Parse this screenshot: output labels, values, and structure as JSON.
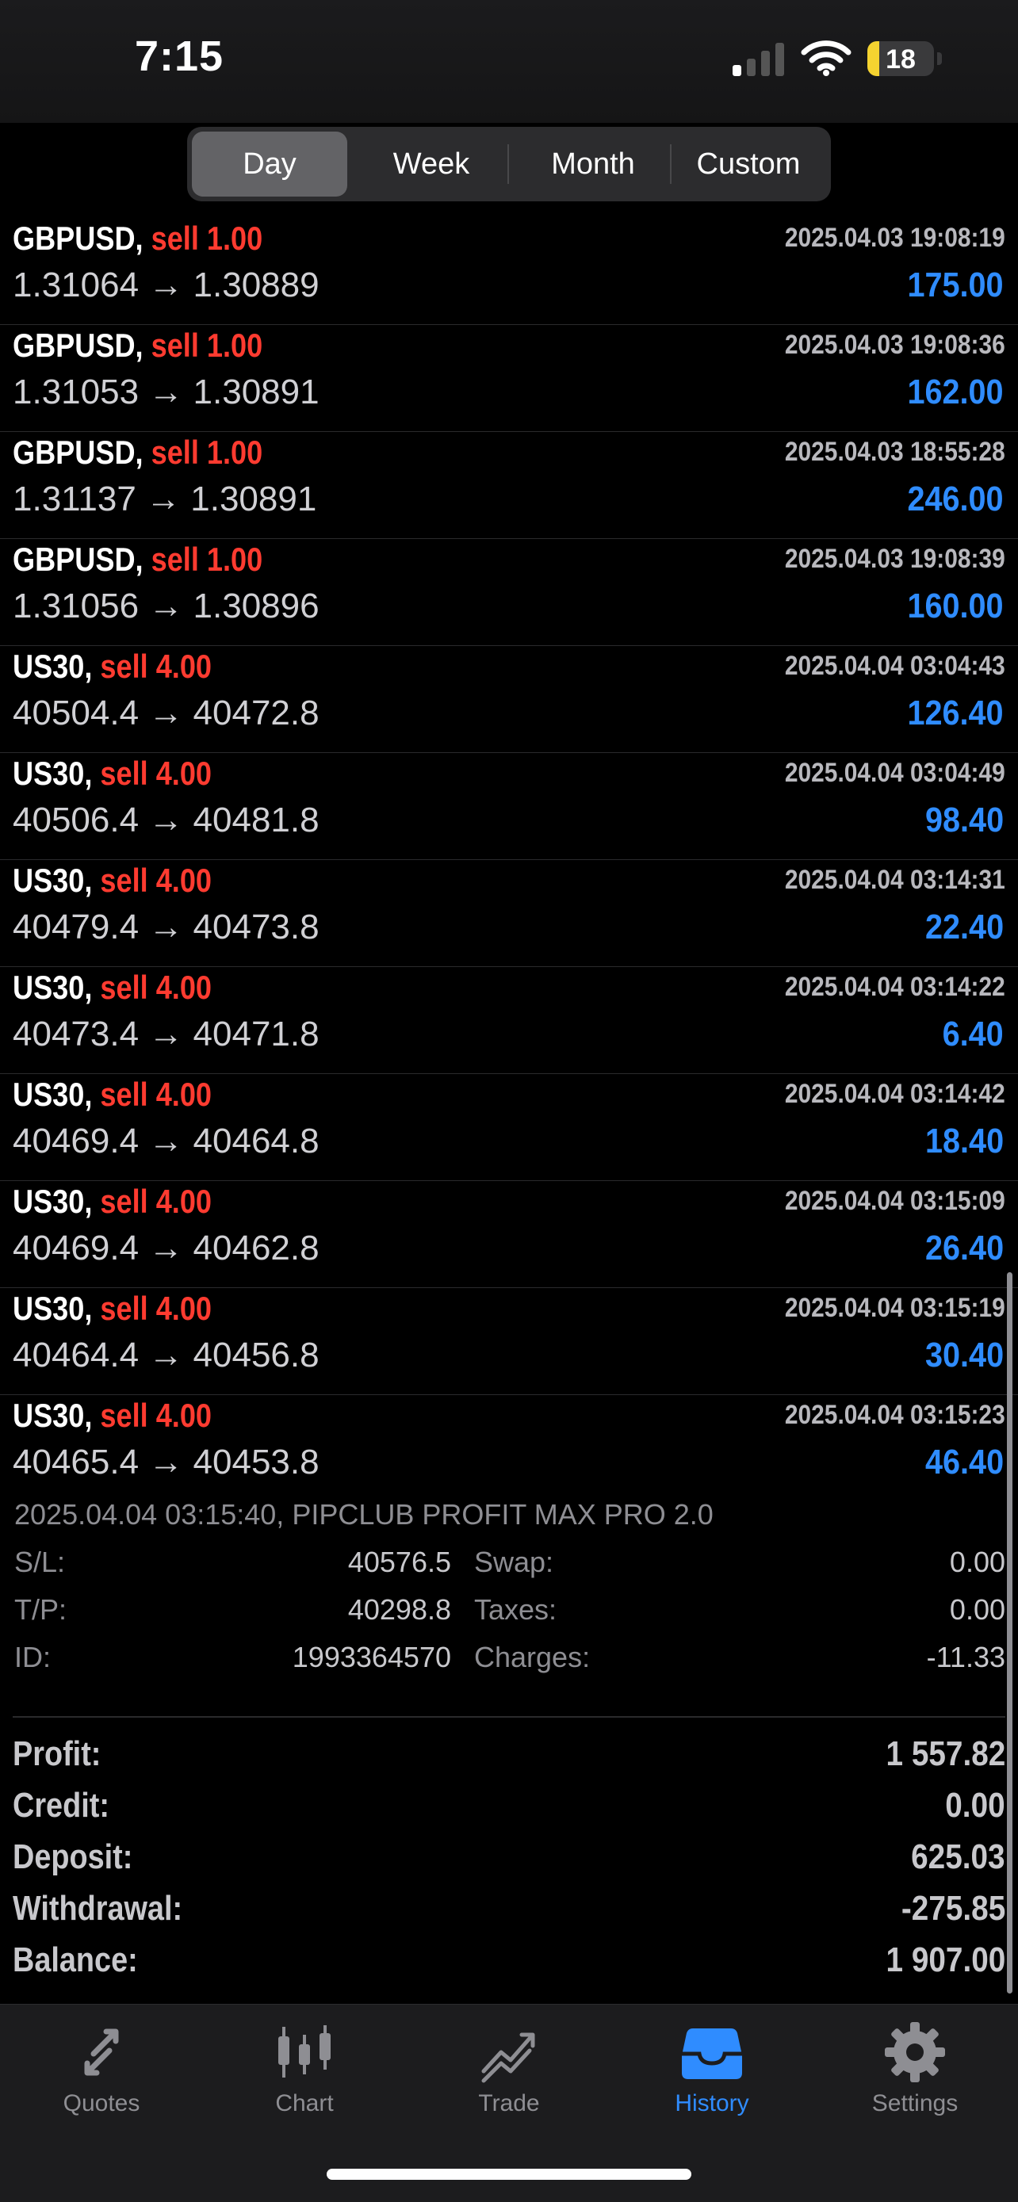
{
  "status_bar": {
    "time": "7:15",
    "battery": "18"
  },
  "period_tabs": [
    {
      "label": "Day",
      "selected": true
    },
    {
      "label": "Week",
      "selected": false
    },
    {
      "label": "Month",
      "selected": false
    },
    {
      "label": "Custom",
      "selected": false
    }
  ],
  "trades": [
    {
      "symbol": "GBPUSD,",
      "side": "sell 1.00",
      "time": "2025.04.03 19:08:19",
      "open": "1.31064",
      "close": "1.30889",
      "profit": "175.00"
    },
    {
      "symbol": "GBPUSD,",
      "side": "sell 1.00",
      "time": "2025.04.03 19:08:36",
      "open": "1.31053",
      "close": "1.30891",
      "profit": "162.00"
    },
    {
      "symbol": "GBPUSD,",
      "side": "sell 1.00",
      "time": "2025.04.03 18:55:28",
      "open": "1.31137",
      "close": "1.30891",
      "profit": "246.00"
    },
    {
      "symbol": "GBPUSD,",
      "side": "sell 1.00",
      "time": "2025.04.03 19:08:39",
      "open": "1.31056",
      "close": "1.30896",
      "profit": "160.00"
    },
    {
      "symbol": "US30,",
      "side": "sell 4.00",
      "time": "2025.04.04 03:04:43",
      "open": "40504.4",
      "close": "40472.8",
      "profit": "126.40"
    },
    {
      "symbol": "US30,",
      "side": "sell 4.00",
      "time": "2025.04.04 03:04:49",
      "open": "40506.4",
      "close": "40481.8",
      "profit": "98.40"
    },
    {
      "symbol": "US30,",
      "side": "sell 4.00",
      "time": "2025.04.04 03:14:31",
      "open": "40479.4",
      "close": "40473.8",
      "profit": "22.40"
    },
    {
      "symbol": "US30,",
      "side": "sell 4.00",
      "time": "2025.04.04 03:14:22",
      "open": "40473.4",
      "close": "40471.8",
      "profit": "6.40"
    },
    {
      "symbol": "US30,",
      "side": "sell 4.00",
      "time": "2025.04.04 03:14:42",
      "open": "40469.4",
      "close": "40464.8",
      "profit": "18.40"
    },
    {
      "symbol": "US30,",
      "side": "sell 4.00",
      "time": "2025.04.04 03:15:09",
      "open": "40469.4",
      "close": "40462.8",
      "profit": "26.40"
    },
    {
      "symbol": "US30,",
      "side": "sell 4.00",
      "time": "2025.04.04 03:15:19",
      "open": "40464.4",
      "close": "40456.8",
      "profit": "30.40"
    },
    {
      "symbol": "US30,",
      "side": "sell 4.00",
      "time": "2025.04.04 03:15:23",
      "open": "40465.4",
      "close": "40453.8",
      "profit": "46.40"
    }
  ],
  "arrow": "→",
  "details": {
    "header": "2025.04.04 03:15:40, PIPCLUB PROFIT MAX PRO 2.0",
    "sl_label": "S/L:",
    "sl": "40576.5",
    "tp_label": "T/P:",
    "tp": "40298.8",
    "id_label": "ID:",
    "id": "1993364570",
    "swap_label": "Swap:",
    "swap": "0.00",
    "taxes_label": "Taxes:",
    "taxes": "0.00",
    "charges_label": "Charges:",
    "charges": "-11.33"
  },
  "summary": [
    {
      "label": "Profit:",
      "value": "1 557.82"
    },
    {
      "label": "Credit:",
      "value": "0.00"
    },
    {
      "label": "Deposit:",
      "value": "625.03"
    },
    {
      "label": "Withdrawal:",
      "value": "-275.85"
    },
    {
      "label": "Balance:",
      "value": "1 907.00"
    }
  ],
  "tabbar": [
    {
      "label": "Quotes",
      "icon": "quotes-icon"
    },
    {
      "label": "Chart",
      "icon": "candlestick-icon"
    },
    {
      "label": "Trade",
      "icon": "trade-icon"
    },
    {
      "label": "History",
      "icon": "history-inbox-icon",
      "active": true
    },
    {
      "label": "Settings",
      "icon": "gear-icon"
    }
  ],
  "colors": {
    "accent": "#2f8cff",
    "sell": "#ff3b30",
    "background": "#000000"
  }
}
